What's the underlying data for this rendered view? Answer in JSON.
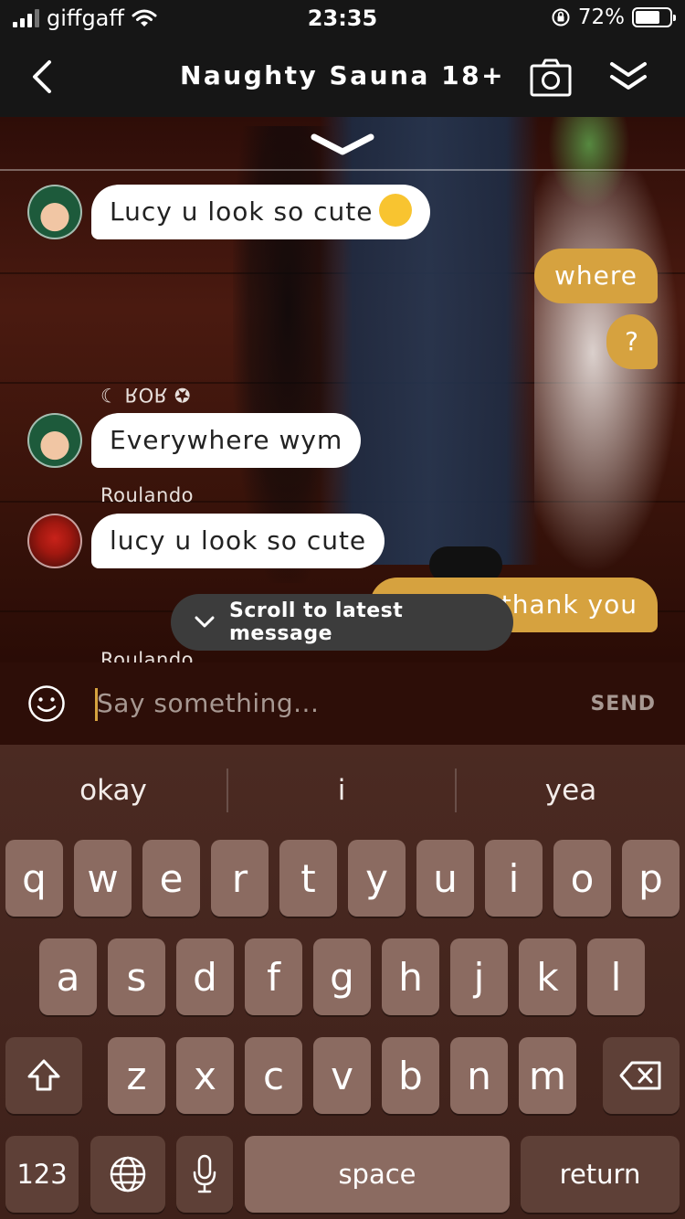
{
  "status_bar": {
    "carrier": "giffgaff",
    "time": "23:35",
    "battery_percent": "72%",
    "battery_level": 0.72
  },
  "header": {
    "title": "Naughty Sauna 18+",
    "back_icon": "chevron-left-icon",
    "camera_icon": "camera-icon",
    "collapse_icon": "double-chevron-down-icon"
  },
  "chat": {
    "messages": [
      {
        "side": "in",
        "text": "Lucy u look so cute",
        "emoji": "weary-face"
      },
      {
        "side": "out",
        "text": "where"
      },
      {
        "side": "out",
        "text": "?"
      },
      {
        "side": "in",
        "name": "☾ ROR ✪",
        "text": "Everywhere wym"
      },
      {
        "side": "in",
        "name": "Roulando",
        "text": "lucy u look so cute"
      },
      {
        "side": "out",
        "text": "thank you"
      },
      {
        "side": "in",
        "name": "Roulando"
      }
    ],
    "scroll_button": "Scroll to latest message"
  },
  "input": {
    "placeholder": "Say something...",
    "send_label": "SEND"
  },
  "keyboard": {
    "suggestions": [
      "okay",
      "i",
      "yea"
    ],
    "row1": [
      "q",
      "w",
      "e",
      "r",
      "t",
      "y",
      "u",
      "i",
      "o",
      "p"
    ],
    "row2": [
      "a",
      "s",
      "d",
      "f",
      "g",
      "h",
      "j",
      "k",
      "l"
    ],
    "row3": [
      "z",
      "x",
      "c",
      "v",
      "b",
      "n",
      "m"
    ],
    "numbers_label": "123",
    "space_label": "space",
    "return_label": "return"
  },
  "colors": {
    "accent": "#d6a23f",
    "header_bg": "#161616",
    "key_bg": "#8b6b61",
    "key_dark": "#5e4037"
  }
}
